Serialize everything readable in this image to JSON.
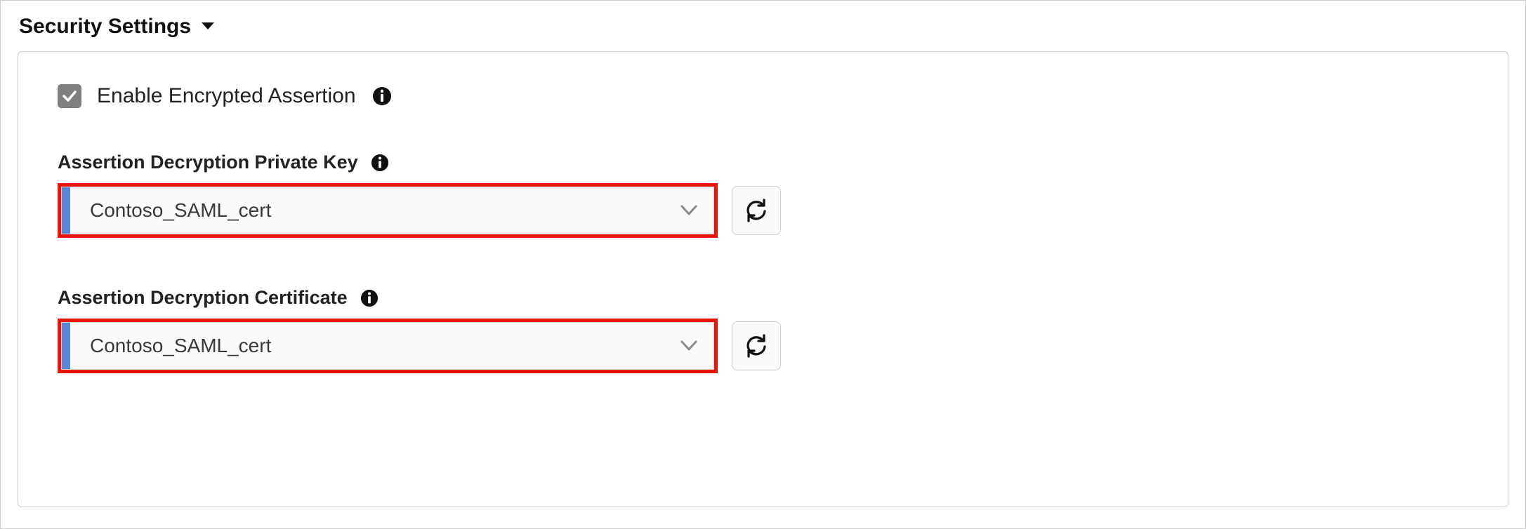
{
  "section": {
    "title": "Security Settings"
  },
  "checkbox": {
    "checked": true,
    "label": "Enable Encrypted Assertion"
  },
  "fields": {
    "private_key": {
      "label": "Assertion Decryption Private Key",
      "value": "Contoso_SAML_cert"
    },
    "certificate": {
      "label": "Assertion Decryption Certificate",
      "value": "Contoso_SAML_cert"
    }
  },
  "colors": {
    "highlight": "#e6160b",
    "accent": "#5a86d4",
    "checkbox_bg": "#7f7f7f"
  }
}
